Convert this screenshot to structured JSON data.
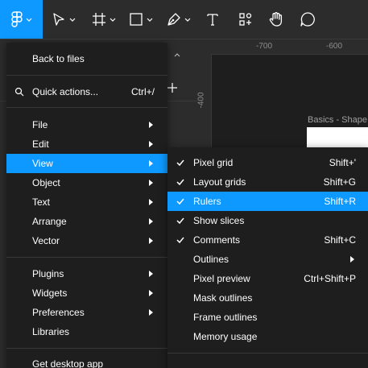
{
  "toolbar": {
    "main_menu_icon": "figma-logo-icon",
    "tools": [
      "move-tool-icon",
      "frame-tool-icon",
      "shape-tool-icon",
      "pen-tool-icon",
      "text-tool-icon",
      "resources-icon",
      "hand-tool-icon",
      "comment-tool-icon"
    ],
    "accent": "#0d99ff"
  },
  "canvas": {
    "ruler_labels": [
      "-700",
      "-600",
      "-400"
    ],
    "frame_label": "Basics - Shape",
    "panel_fragment": "s"
  },
  "main_menu": {
    "back": "Back to files",
    "quick_actions": {
      "label": "Quick actions...",
      "shortcut": "Ctrl+/"
    },
    "items": [
      {
        "label": "File"
      },
      {
        "label": "Edit"
      },
      {
        "label": "View"
      },
      {
        "label": "Object"
      },
      {
        "label": "Text"
      },
      {
        "label": "Arrange"
      },
      {
        "label": "Vector"
      }
    ],
    "items2": [
      {
        "label": "Plugins"
      },
      {
        "label": "Widgets"
      },
      {
        "label": "Preferences"
      },
      {
        "label": "Libraries"
      }
    ],
    "desktop": "Get desktop app"
  },
  "view_menu": {
    "items": [
      {
        "label": "Pixel grid",
        "shortcut": "Shift+'",
        "checked": true
      },
      {
        "label": "Layout grids",
        "shortcut": "Shift+G",
        "checked": true
      },
      {
        "label": "Rulers",
        "shortcut": "Shift+R",
        "checked": true
      },
      {
        "label": "Show slices",
        "shortcut": "",
        "checked": true
      },
      {
        "label": "Comments",
        "shortcut": "Shift+C",
        "checked": true
      },
      {
        "label": "Outlines",
        "shortcut": "",
        "checked": false
      },
      {
        "label": "Pixel preview",
        "shortcut": "Ctrl+Shift+P",
        "checked": false
      },
      {
        "label": "Mask outlines",
        "shortcut": "",
        "checked": false
      },
      {
        "label": "Frame outlines",
        "shortcut": "",
        "checked": false
      },
      {
        "label": "Memory usage",
        "shortcut": "",
        "checked": false
      }
    ]
  }
}
